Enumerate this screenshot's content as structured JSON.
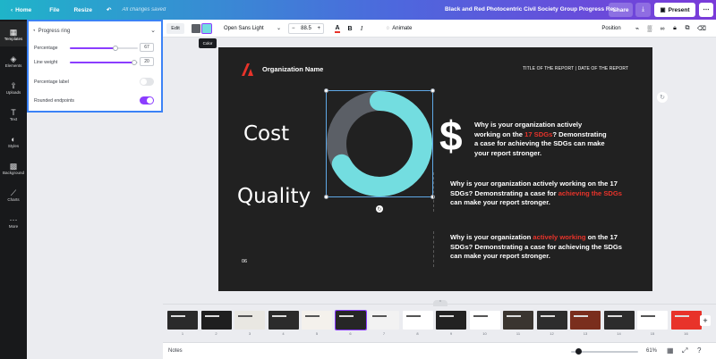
{
  "topbar": {
    "home": "Home",
    "file": "File",
    "resize": "Resize",
    "saved_status": "All changes saved",
    "doc_title": "Black and Red Photocentric Civil Society Group Progress Re...",
    "share": "Share",
    "present": "Present"
  },
  "rail": [
    {
      "label": "Templates",
      "icon": "template-icon"
    },
    {
      "label": "Elements",
      "icon": "elements-icon"
    },
    {
      "label": "Uploads",
      "icon": "upload-icon"
    },
    {
      "label": "Text",
      "icon": "text-icon"
    },
    {
      "label": "Styles",
      "icon": "styles-icon"
    },
    {
      "label": "Background",
      "icon": "background-icon"
    },
    {
      "label": "Charts",
      "icon": "charts-icon"
    },
    {
      "label": "More",
      "icon": "more-icon"
    }
  ],
  "panel": {
    "title": "Progress ring",
    "percentage_label": "Percentage",
    "percentage_value": "67",
    "percentage_fraction": 0.67,
    "line_weight_label": "Line weight",
    "line_weight_value": "20",
    "line_weight_fraction": 0.95,
    "percentage_label_toggle": "Percentage label",
    "percentage_label_on": false,
    "rounded_label": "Rounded endpoints",
    "rounded_on": true
  },
  "toolbar": {
    "edit": "Edit",
    "font": "Open Sans Light",
    "font_size": "88.5",
    "animate": "Animate",
    "position": "Position",
    "tooltip": "Color",
    "swatch_dark": "#5b5f66",
    "swatch_cyan": "#73dde0"
  },
  "slide": {
    "org_name": "Organization Name",
    "report_label": "TITLE OF THE REPORT | DATE OF THE REPORT",
    "cost": "Cost",
    "quality": "Quality",
    "page_num": "06",
    "dollar": "$",
    "ring_percent": 0.67,
    "ring_color": "#73dde0",
    "ring_track": "#5b5f66",
    "accent": "#e8332a",
    "p1": {
      "a": "Why is your organization actively working on the ",
      "hl": "17 SDGs",
      "b": "? Demonstrating a case for achieving the SDGs can make your report stronger."
    },
    "p2": {
      "a": "Why is your organization actively working on the 17 SDGs? Demonstrating a case for ",
      "hl": "achieving the SDGs",
      "b": " can make your report stronger."
    },
    "p3": {
      "a": "Why is your organization ",
      "hl": "actively working",
      "b": " on the 17 SDGs? Demonstrating a case for achieving the SDGs can make your report stronger."
    }
  },
  "filmstrip": {
    "numbers": [
      "1",
      "2",
      "3",
      "4",
      "5",
      "6",
      "7",
      "8",
      "9",
      "10",
      "11",
      "12",
      "13",
      "14",
      "15",
      "16"
    ]
  },
  "footer": {
    "notes": "Notes",
    "zoom": "61%"
  }
}
